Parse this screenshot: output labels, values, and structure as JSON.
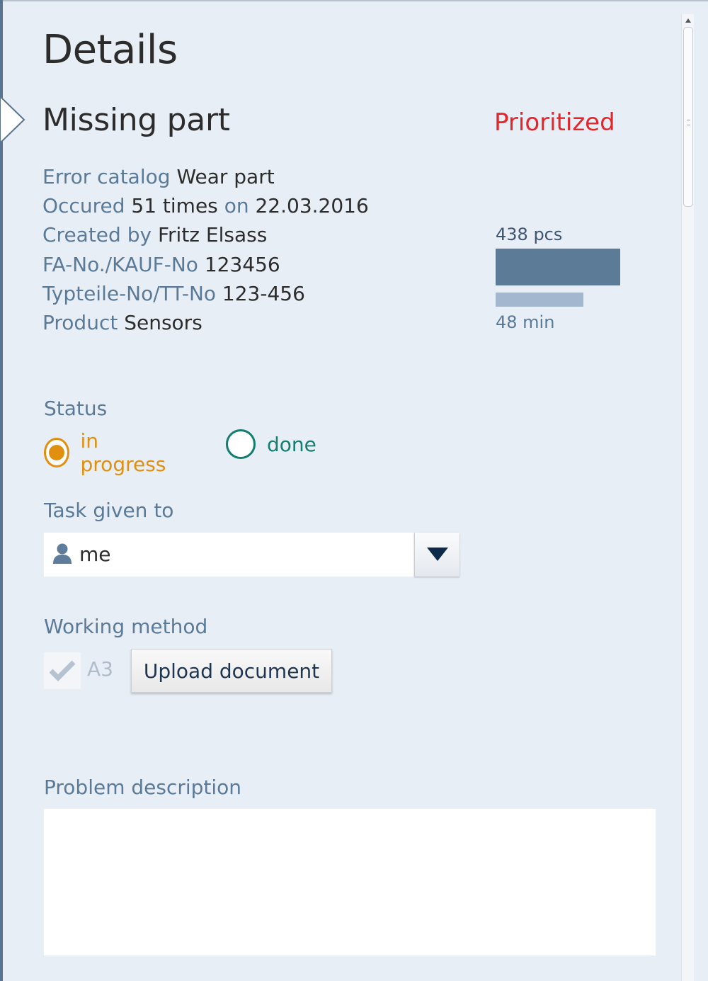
{
  "panel": {
    "title": "Details"
  },
  "issue": {
    "title": "Missing part",
    "priority": "Prioritized",
    "priority_color": "#e4262b"
  },
  "info": {
    "error_catalog_label": "Error catalog",
    "error_catalog_value": "Wear part",
    "occured_label": "Occured",
    "occured_count": "51 times",
    "on_label": "on",
    "occured_date": "22.03.2016",
    "created_by_label": "Created by",
    "created_by_value": "Fritz Elsass",
    "fa_no_label": "FA-No./KAUF-No",
    "fa_no_value": "123456",
    "typteile_label": "Typteile-No/TT-No",
    "typteile_value": "123-456",
    "product_label": "Product",
    "product_value": "Sensors"
  },
  "metrics": {
    "pieces_label": "438 pcs",
    "minutes_label": "48 min"
  },
  "status": {
    "label": "Status",
    "options": [
      {
        "label": "in progress",
        "selected": true,
        "color": "#e0900e"
      },
      {
        "label": "done",
        "selected": false,
        "color": "#137d70"
      }
    ]
  },
  "task": {
    "label": "Task given to",
    "value": "me",
    "icon": "user-icon"
  },
  "working_method": {
    "label": "Working method",
    "checkbox_label": "A3",
    "checked": true,
    "upload_label": "Upload document"
  },
  "problem": {
    "label": "Problem description",
    "value": ""
  }
}
